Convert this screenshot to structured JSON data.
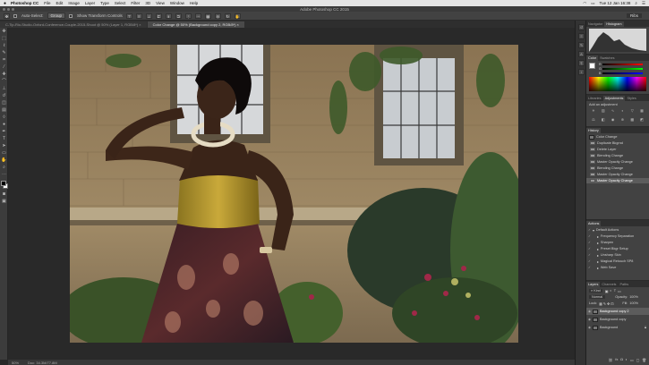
{
  "menubar": {
    "apple": "",
    "app_name": "Photoshop CC",
    "items": [
      "File",
      "Edit",
      "Image",
      "Layer",
      "Type",
      "Select",
      "Filter",
      "3D",
      "View",
      "Window",
      "Help"
    ],
    "clock": "Tue 12 Jan 16:38"
  },
  "window": {
    "title": "Adobe Photoshop CC 2015"
  },
  "options": {
    "auto_select_label": "Auto-Select:",
    "auto_select_value": "Group",
    "transform_label": "Show Transform Controls",
    "workspace": "Ribs"
  },
  "tabs": [
    {
      "label": "C-Tip-Rio-Studio-Oxford-Conference-Couple-2015-Shoot @ 50% (Layer 1, RGB/8*) ×",
      "active": false
    },
    {
      "label": "Color Change @ 50% (Background copy 2, RGB/8*) ×",
      "active": true
    }
  ],
  "status": {
    "zoom": "50%",
    "doc": "Doc: 34.3M/77.8M"
  },
  "panels": {
    "navigator_tabs": [
      "Navigator",
      "Histogram"
    ],
    "color_tabs": [
      "Color",
      "Swatches"
    ],
    "color_sliders": [
      "R",
      "G",
      "B"
    ],
    "adjust_tabs": [
      "Libraries",
      "Adjustments",
      "Styles"
    ],
    "adjust_hint": "Add an adjustment",
    "history_tab": "History",
    "history_snapshot": "Color Change",
    "history_items": [
      "Duplicate Bkgrnd",
      "Delete Layer",
      "Blending Change",
      "Master Opacity Change",
      "Blending Change",
      "Master Opacity Change",
      "Master Opacity Change"
    ],
    "actions_tab": "Actions",
    "actions_items": [
      "Default Actions",
      "Frequency Separation",
      "Sharpen",
      "Preset Bkgr Setup",
      "Unsharp Skin",
      "Magical Retouch SP8",
      "Web Save"
    ],
    "layers_tabs": [
      "Layers",
      "Channels",
      "Paths"
    ],
    "kind_label": "Kind",
    "blend_mode": "Normal",
    "opacity_label": "Opacity:",
    "opacity_value": "100%",
    "lock_label": "Lock:",
    "fill_label": "Fill:",
    "fill_value": "100%",
    "layers": [
      {
        "name": "Background copy 2",
        "selected": true
      },
      {
        "name": "Background copy",
        "selected": false
      },
      {
        "name": "Background",
        "selected": false
      }
    ]
  },
  "colors": {
    "accent": "#5c5c5c",
    "panel": "#424242",
    "canvas": "#292929"
  }
}
